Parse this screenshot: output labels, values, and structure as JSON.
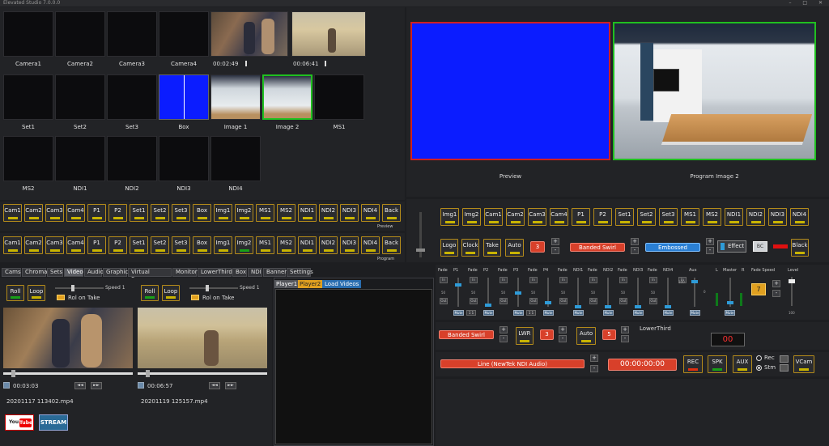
{
  "window": {
    "title": "Elevated Studio 7.0.0.0",
    "controls": "– □ ✕"
  },
  "sources": {
    "row1": [
      {
        "label": "Camera1"
      },
      {
        "label": "Camera2"
      },
      {
        "label": "Camera3"
      },
      {
        "label": "Camera4"
      },
      {
        "label": ""
      },
      {
        "label": ""
      }
    ],
    "row1_timecodes": [
      "00:02:49",
      "00:06:41"
    ],
    "row2": [
      {
        "label": "Set1"
      },
      {
        "label": "Set2"
      },
      {
        "label": "Set3"
      },
      {
        "label": "Box"
      },
      {
        "label": "Image 1"
      },
      {
        "label": "Image 2"
      },
      {
        "label": "MS1"
      }
    ],
    "row3": [
      {
        "label": "MS2"
      },
      {
        "label": "NDI1"
      },
      {
        "label": "NDI2"
      },
      {
        "label": "NDI3"
      },
      {
        "label": "NDI4"
      }
    ]
  },
  "monitors": {
    "preview_label": "Preview",
    "program_label": "Program Image 2"
  },
  "preview_bus": {
    "buttons": [
      "Cam1",
      "Cam2",
      "Cam3",
      "Cam4",
      "P1",
      "P2",
      "Set1",
      "Set2",
      "Set3",
      "Box",
      "Img1",
      "Img2",
      "MS1",
      "MS2",
      "NDI1",
      "NDI2",
      "NDI3",
      "NDI4",
      "Back"
    ],
    "label": "Preview"
  },
  "program_bus": {
    "buttons": [
      "Cam1",
      "Cam2",
      "Cam3",
      "Cam4",
      "P1",
      "P2",
      "Set1",
      "Set2",
      "Set3",
      "Box",
      "Img1",
      "Img2",
      "MS1",
      "MS2",
      "NDI1",
      "NDI2",
      "NDI3",
      "NDI4",
      "Back"
    ],
    "label": "Program"
  },
  "right_bus": {
    "buttons": [
      "Img1",
      "Img2",
      "Cam1",
      "Cam2",
      "Cam3",
      "Cam4",
      "P1",
      "P2",
      "Set1",
      "Set2",
      "Set3",
      "MS1",
      "MS2",
      "NDI1",
      "NDI2",
      "NDI3",
      "NDI4"
    ]
  },
  "transitions": {
    "logo": "Logo",
    "clock": "Clock",
    "take": "Take",
    "auto": "Auto",
    "rate": "3",
    "transition1": "Banded Swirl",
    "transition2": "Embossed",
    "effect": "Effect",
    "bc": "BC",
    "black": "Black"
  },
  "tabs": [
    "Cams",
    "Chroma",
    "Sets",
    "Video",
    "Audio",
    "Graphics",
    "Virtual Screens",
    "Monitors",
    "LowerThirds",
    "Box",
    "NDI",
    "Banner",
    "Settings"
  ],
  "active_tab": "Video",
  "players": [
    {
      "roll": "Roll",
      "loop": "Loop",
      "speed": "Speed 1",
      "rol_on_take": "Rol on Take",
      "time": "00:03:03",
      "file": "20201117 113402.mp4",
      "rew": "◄◄",
      "ff": "►►"
    },
    {
      "roll": "Roll",
      "loop": "Loop",
      "speed": "Speed 1",
      "rol_on_take": "Rol on Take",
      "time": "00:06:57",
      "file": "20201119 125157.mp4",
      "rew": "◄◄",
      "ff": "►►"
    }
  ],
  "player_list": {
    "tabs": [
      "Player1",
      "Player2",
      "Load Videos"
    ]
  },
  "streaming": {
    "youtube": "YouTube",
    "stream": "STREAM"
  },
  "audio_mixer": {
    "channels": [
      {
        "fade": "Fade",
        "name": "P1",
        "in": "In",
        "out": "Out",
        "mute": "Mute"
      },
      {
        "fade": "Fade",
        "name": "P2",
        "in": "In",
        "out": "Out",
        "mute": "Mute"
      },
      {
        "fade": "Fade",
        "name": "P3",
        "in": "In",
        "out": "Out",
        "mute": "Mute"
      },
      {
        "fade": "Fade",
        "name": "P4",
        "in": "In",
        "out": "Out",
        "mute": "Mute"
      },
      {
        "fade": "Fade",
        "name": "NDI1",
        "in": "In",
        "out": "Out",
        "mute": "Mute"
      },
      {
        "fade": "Fade",
        "name": "NDI2",
        "in": "In",
        "out": "Out",
        "mute": "Mute"
      },
      {
        "fade": "Fade",
        "name": "NDI3",
        "in": "In",
        "out": "Out",
        "mute": "Mute"
      },
      {
        "fade": "Fade",
        "name": "NDI4",
        "in": "In",
        "out": "Out",
        "mute": "Mute"
      }
    ],
    "aux": "Aux",
    "l": "L",
    "master": "Master",
    "r": "R",
    "fade_speed": "Fade Speed",
    "fade_speed_value": "7",
    "level": "Level",
    "scale_top": "100",
    "scale_mid": "50",
    "scale_bot": "0",
    "level_max": "100"
  },
  "lower_third": {
    "transition": "Banded Swirl",
    "lwr": "LWR",
    "rate": "3",
    "auto": "Auto",
    "duration": "5",
    "label": "LowerThird",
    "counter": "00"
  },
  "recording": {
    "audio_source": "Line (NewTek NDI Audio)",
    "timer": "00:00:00:00",
    "rec": "REC",
    "spk": "SPK",
    "aux": "AUX",
    "rec_radio": "Rec",
    "stm_radio": "Stm",
    "vcam": "VCam"
  },
  "colors": {
    "accent_gold": "#b48b1a",
    "preview_border": "#d02020",
    "program_border": "#20c020",
    "preview_fill": "#0b1cff"
  }
}
